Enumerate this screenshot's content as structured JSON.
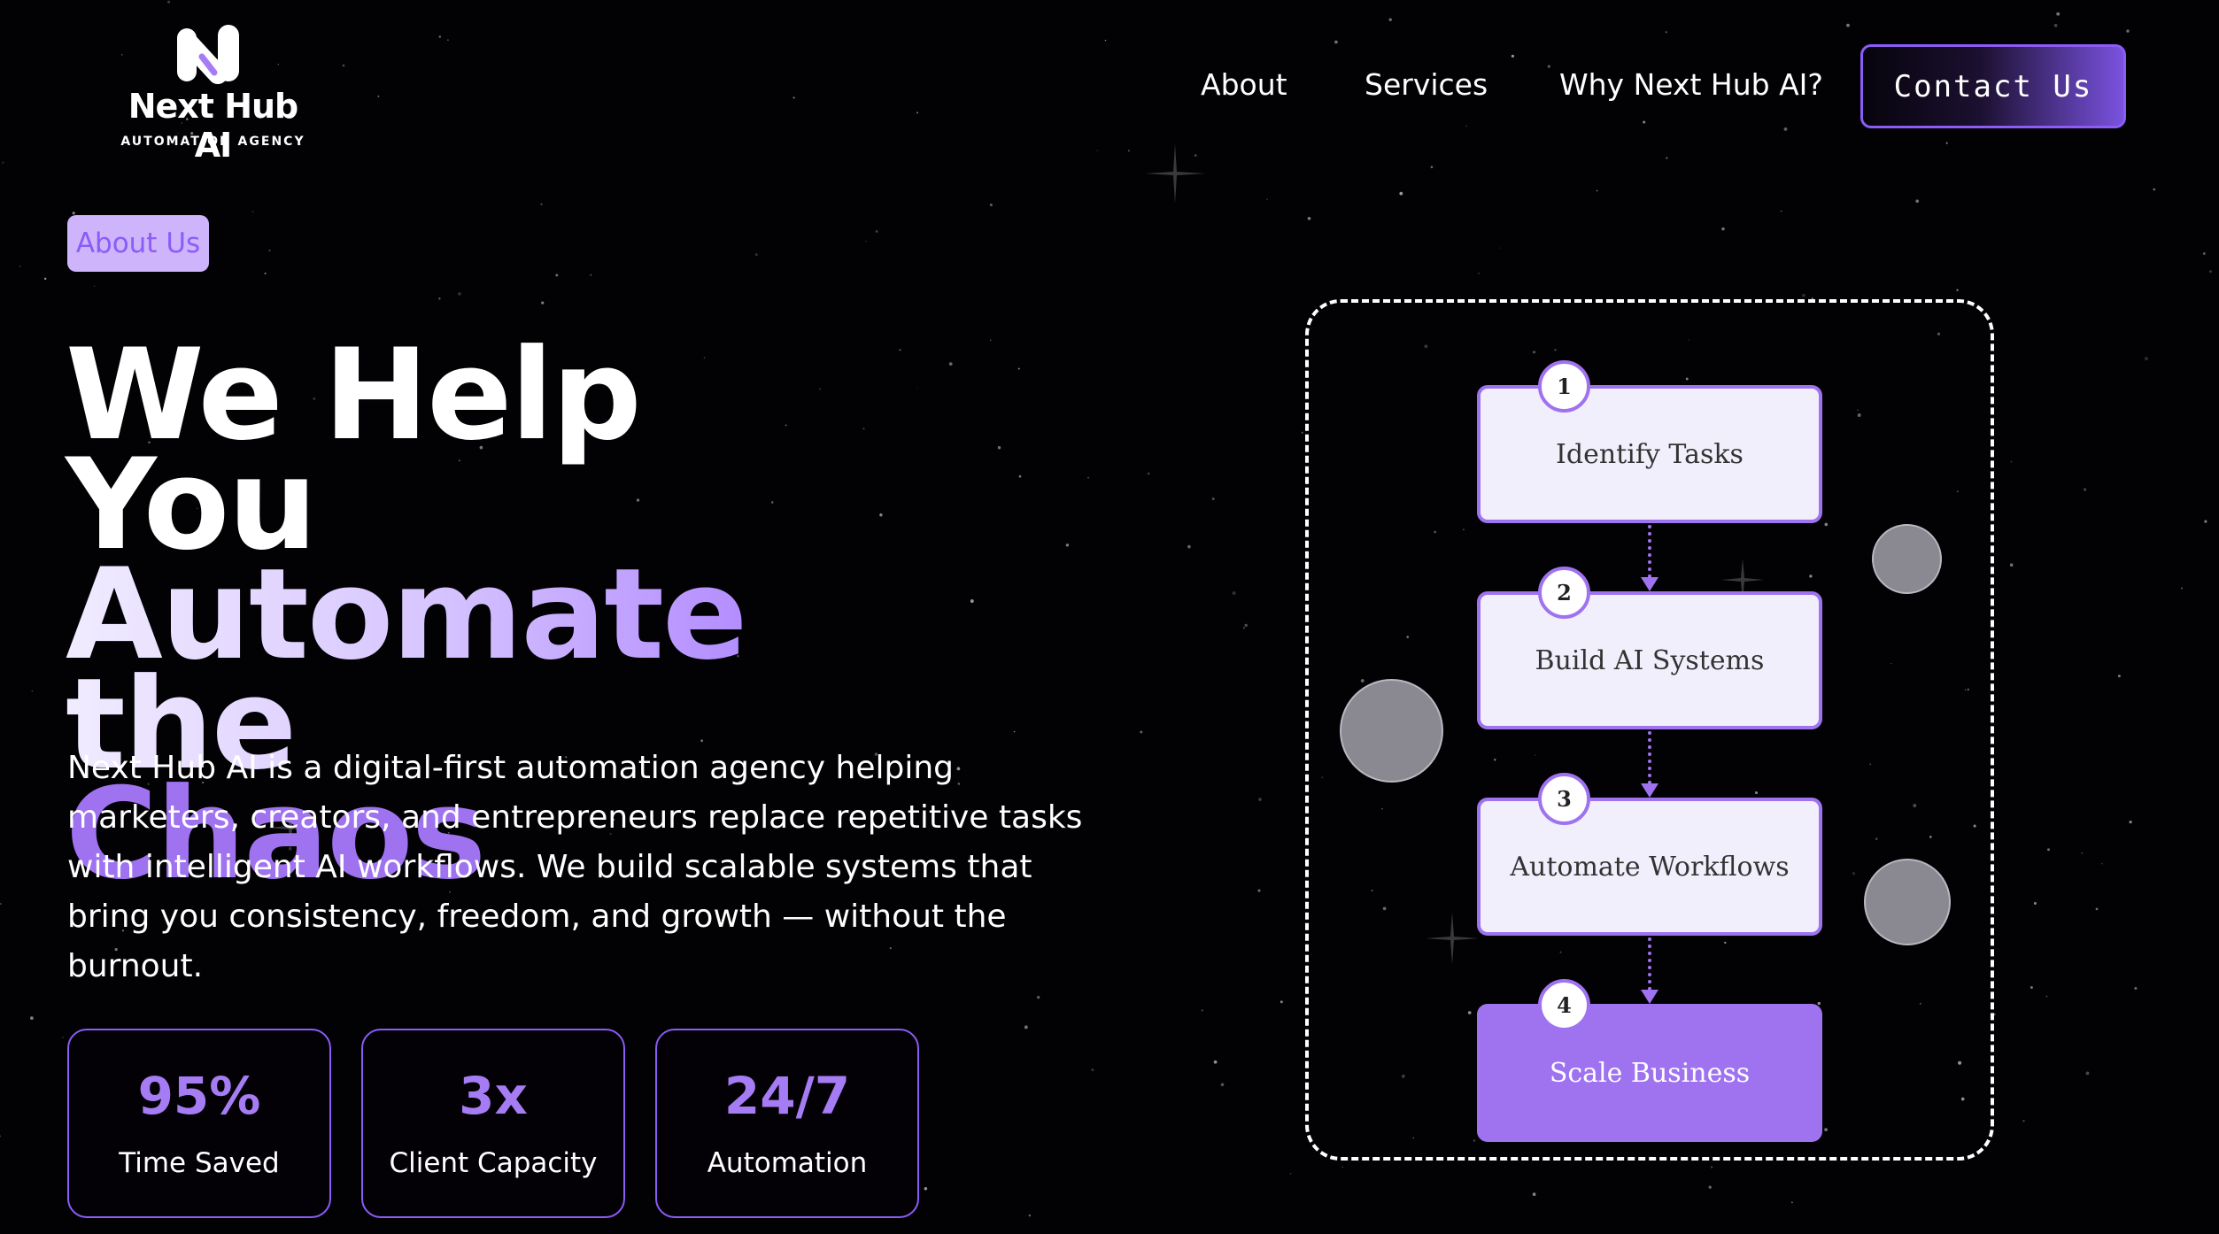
{
  "brand": {
    "name": "Next Hub AI",
    "tagline": "AUTOMATION AGENCY",
    "logo_icon": "nh-monogram-icon"
  },
  "nav": {
    "links": [
      {
        "label": "About"
      },
      {
        "label": "Services"
      },
      {
        "label": "Why Next Hub AI?"
      }
    ],
    "cta_label": "Contact Us"
  },
  "hero": {
    "badge": "About Us",
    "headline": {
      "line1": "We Help You",
      "line2": "Automate the",
      "line3": "Chaos"
    },
    "description": "Next Hub AI is a digital-first automation agency helping marketers, creators, and entrepreneurs replace repetitive tasks with intelligent AI workflows. We build scalable systems that bring you consistency, freedom, and growth — without the burnout."
  },
  "stats": [
    {
      "value": "95%",
      "label": "Time Saved"
    },
    {
      "value": "3x",
      "label": "Client Capacity"
    },
    {
      "value": "24/7",
      "label": "Automation"
    }
  ],
  "flow": {
    "steps": [
      {
        "number": "1",
        "label": "Identify Tasks"
      },
      {
        "number": "2",
        "label": "Build AI Systems"
      },
      {
        "number": "3",
        "label": "Automate Workflows"
      },
      {
        "number": "4",
        "label": "Scale Business"
      }
    ]
  },
  "colors": {
    "accent": "#9f73f0",
    "accent_border": "#8b5cf6",
    "badge_bg": "#cdb4fb",
    "background": "#020103",
    "step_bg": "#f1effb"
  }
}
